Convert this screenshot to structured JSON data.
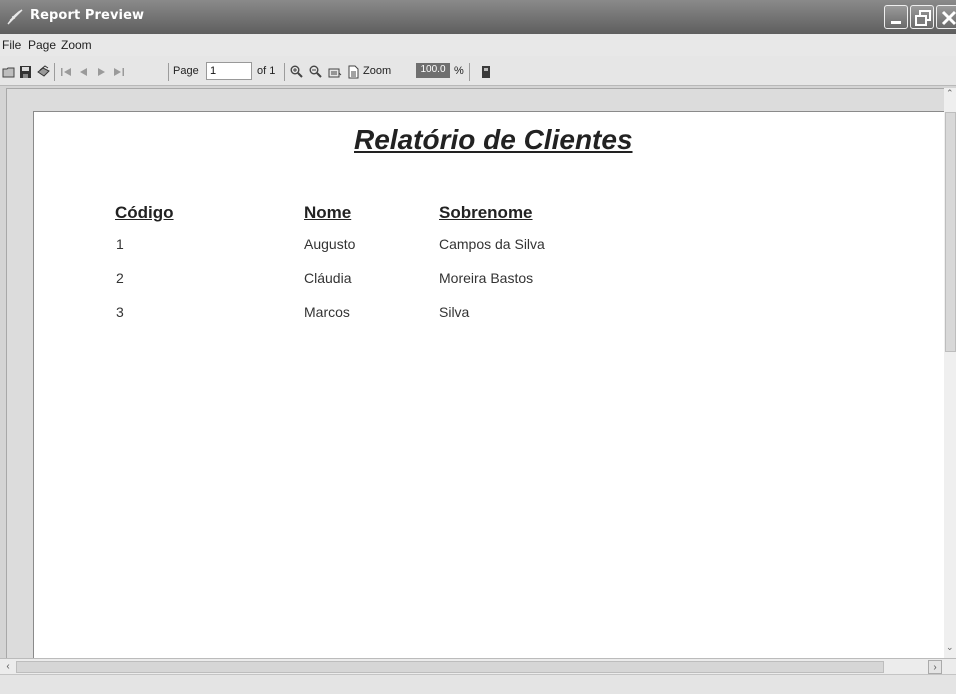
{
  "window": {
    "title": "Report Preview"
  },
  "menu": {
    "items": [
      "File",
      "Page",
      "Zoom"
    ]
  },
  "toolbar": {
    "page_label": "Page",
    "page_value": "1",
    "of_label": "of 1",
    "zoom_label": "Zoom",
    "zoom_value": "100.0",
    "percent_label": "%"
  },
  "report": {
    "title": "Relatório de Clientes",
    "columns": [
      "Código",
      "Nome",
      "Sobrenome"
    ],
    "rows": [
      [
        "1",
        "Augusto",
        "Campos da Silva"
      ],
      [
        "2",
        "Cláudia",
        "Moreira Bastos"
      ],
      [
        "3",
        "Marcos",
        "Silva"
      ]
    ]
  }
}
